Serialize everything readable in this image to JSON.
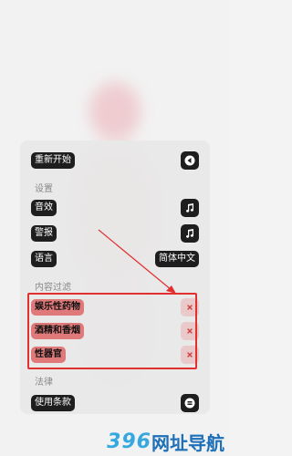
{
  "menu": {
    "restart_label": "重新开始",
    "settings_section": "设置",
    "sound_label": "音效",
    "alarm_label": "警报",
    "language_label": "语言",
    "language_value": "简体中文",
    "content_filter_section": "内容过滤",
    "filters": [
      {
        "label": "娱乐性药物",
        "state": "off"
      },
      {
        "label": "酒精和香烟",
        "state": "off"
      },
      {
        "label": "性器官",
        "state": "off"
      }
    ],
    "law_section": "法律",
    "terms_label": "使用条款"
  },
  "icons": {
    "restart": "play-back-icon",
    "sound": "music-note-icon",
    "alarm": "music-note-icon",
    "filter_toggle": "close-x-icon",
    "terms": "menu-lines-icon"
  },
  "colors": {
    "pill_dark": "#1e1e1e",
    "filter_red": "#e07a7a",
    "highlight_border": "#e03030",
    "watermark_num": "#35a8e0",
    "watermark_text": "#1d6fb8"
  },
  "watermark": {
    "number": "396",
    "text": "网址导航"
  }
}
